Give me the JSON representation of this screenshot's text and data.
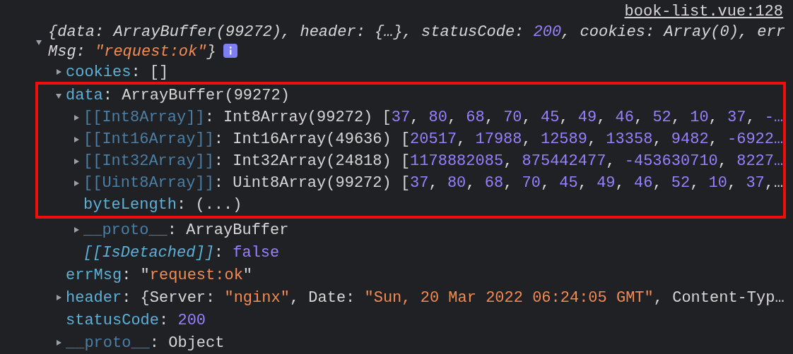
{
  "source_link": "book-list.vue:128",
  "summary": {
    "expanded": true,
    "segments": [
      {
        "kind": "plain",
        "text": "{data: ArrayBuffer(99272), header: {…}, statusCode: "
      },
      {
        "kind": "number",
        "text": "200"
      },
      {
        "kind": "plain",
        "text": ", cookies: Array(0), errMsg: "
      },
      {
        "kind": "string",
        "text": "\"request:ok\""
      },
      {
        "kind": "plain",
        "text": "}"
      }
    ]
  },
  "rows": [
    {
      "kind": "node",
      "key": "cookies",
      "internal": false,
      "italic": false,
      "expanded": false,
      "highlighted": false,
      "value": [
        {
          "kind": "plain",
          "text": ": []"
        }
      ]
    },
    {
      "kind": "node",
      "key": "data",
      "internal": false,
      "italic": false,
      "expanded": true,
      "highlighted": true,
      "value": [
        {
          "kind": "plain",
          "text": ": ArrayBuffer(99272)"
        }
      ],
      "children": [
        {
          "kind": "node",
          "key": "[[Int8Array]]",
          "internal": true,
          "italic": false,
          "expanded": false,
          "highlighted": true,
          "value": [
            {
              "kind": "plain",
              "text": ": Int8Array(99272) ["
            },
            {
              "kind": "number",
              "text": "37"
            },
            {
              "kind": "plain",
              "text": ", "
            },
            {
              "kind": "number",
              "text": "80"
            },
            {
              "kind": "plain",
              "text": ", "
            },
            {
              "kind": "number",
              "text": "68"
            },
            {
              "kind": "plain",
              "text": ", "
            },
            {
              "kind": "number",
              "text": "70"
            },
            {
              "kind": "plain",
              "text": ", "
            },
            {
              "kind": "number",
              "text": "45"
            },
            {
              "kind": "plain",
              "text": ", "
            },
            {
              "kind": "number",
              "text": "49"
            },
            {
              "kind": "plain",
              "text": ", "
            },
            {
              "kind": "number",
              "text": "46"
            },
            {
              "kind": "plain",
              "text": ", "
            },
            {
              "kind": "number",
              "text": "52"
            },
            {
              "kind": "plain",
              "text": ", "
            },
            {
              "kind": "number",
              "text": "10"
            },
            {
              "kind": "plain",
              "text": ", "
            },
            {
              "kind": "number",
              "text": "37"
            },
            {
              "kind": "plain",
              "text": ", "
            },
            {
              "kind": "number",
              "text": "-…"
            }
          ]
        },
        {
          "kind": "node",
          "key": "[[Int16Array]]",
          "internal": true,
          "italic": false,
          "expanded": false,
          "highlighted": true,
          "value": [
            {
              "kind": "plain",
              "text": ": Int16Array(49636) ["
            },
            {
              "kind": "number",
              "text": "20517"
            },
            {
              "kind": "plain",
              "text": ", "
            },
            {
              "kind": "number",
              "text": "17988"
            },
            {
              "kind": "plain",
              "text": ", "
            },
            {
              "kind": "number",
              "text": "12589"
            },
            {
              "kind": "plain",
              "text": ", "
            },
            {
              "kind": "number",
              "text": "13358"
            },
            {
              "kind": "plain",
              "text": ", "
            },
            {
              "kind": "number",
              "text": "9482"
            },
            {
              "kind": "plain",
              "text": ", "
            },
            {
              "kind": "number",
              "text": "-6922…"
            }
          ]
        },
        {
          "kind": "node",
          "key": "[[Int32Array]]",
          "internal": true,
          "italic": false,
          "expanded": false,
          "highlighted": true,
          "value": [
            {
              "kind": "plain",
              "text": ": Int32Array(24818) ["
            },
            {
              "kind": "number",
              "text": "1178882085"
            },
            {
              "kind": "plain",
              "text": ", "
            },
            {
              "kind": "number",
              "text": "875442477"
            },
            {
              "kind": "plain",
              "text": ", "
            },
            {
              "kind": "number",
              "text": "-453630710"
            },
            {
              "kind": "plain",
              "text": ", "
            },
            {
              "kind": "number",
              "text": "8227…"
            }
          ]
        },
        {
          "kind": "node",
          "key": "[[Uint8Array]]",
          "internal": true,
          "italic": false,
          "expanded": false,
          "highlighted": true,
          "value": [
            {
              "kind": "plain",
              "text": ": Uint8Array(99272) ["
            },
            {
              "kind": "number",
              "text": "37"
            },
            {
              "kind": "plain",
              "text": ", "
            },
            {
              "kind": "number",
              "text": "80"
            },
            {
              "kind": "plain",
              "text": ", "
            },
            {
              "kind": "number",
              "text": "68"
            },
            {
              "kind": "plain",
              "text": ", "
            },
            {
              "kind": "number",
              "text": "70"
            },
            {
              "kind": "plain",
              "text": ", "
            },
            {
              "kind": "number",
              "text": "45"
            },
            {
              "kind": "plain",
              "text": ", "
            },
            {
              "kind": "number",
              "text": "49"
            },
            {
              "kind": "plain",
              "text": ", "
            },
            {
              "kind": "number",
              "text": "46"
            },
            {
              "kind": "plain",
              "text": ", "
            },
            {
              "kind": "number",
              "text": "52"
            },
            {
              "kind": "plain",
              "text": ", "
            },
            {
              "kind": "number",
              "text": "10"
            },
            {
              "kind": "plain",
              "text": ", "
            },
            {
              "kind": "number",
              "text": "37"
            },
            {
              "kind": "plain",
              "text": ",…"
            }
          ]
        },
        {
          "kind": "leaf",
          "key": "byteLength",
          "internal": false,
          "italic": false,
          "highlighted": true,
          "value": [
            {
              "kind": "plain",
              "text": ": (...)"
            }
          ]
        },
        {
          "kind": "node",
          "key": "__proto__",
          "internal": true,
          "italic": false,
          "expanded": false,
          "highlighted": false,
          "value": [
            {
              "kind": "plain",
              "text": ": ArrayBuffer"
            }
          ]
        },
        {
          "kind": "leaf",
          "key": "[[IsDetached]]",
          "internal": true,
          "italic": true,
          "highlighted": false,
          "value": [
            {
              "kind": "plain",
              "text": ": "
            },
            {
              "kind": "number",
              "text": "false"
            }
          ]
        }
      ]
    },
    {
      "kind": "leaf",
      "key": "errMsg",
      "internal": false,
      "italic": false,
      "highlighted": false,
      "value": [
        {
          "kind": "plain",
          "text": ": \""
        },
        {
          "kind": "string",
          "text": "request:ok"
        },
        {
          "kind": "plain",
          "text": "\""
        }
      ]
    },
    {
      "kind": "node",
      "key": "header",
      "internal": false,
      "italic": false,
      "expanded": false,
      "highlighted": false,
      "value": [
        {
          "kind": "plain",
          "text": ": {Server: "
        },
        {
          "kind": "string",
          "text": "\"nginx\""
        },
        {
          "kind": "plain",
          "text": ", Date: "
        },
        {
          "kind": "string",
          "text": "\"Sun, 20 Mar 2022 06:24:05 GMT\""
        },
        {
          "kind": "plain",
          "text": ", Content-Typ…"
        }
      ]
    },
    {
      "kind": "leaf",
      "key": "statusCode",
      "internal": false,
      "italic": false,
      "highlighted": false,
      "value": [
        {
          "kind": "plain",
          "text": ": "
        },
        {
          "kind": "number",
          "text": "200"
        }
      ]
    },
    {
      "kind": "node",
      "key": "__proto__",
      "internal": true,
      "italic": false,
      "expanded": false,
      "highlighted": false,
      "value": [
        {
          "kind": "plain",
          "text": ": Object"
        }
      ]
    }
  ]
}
